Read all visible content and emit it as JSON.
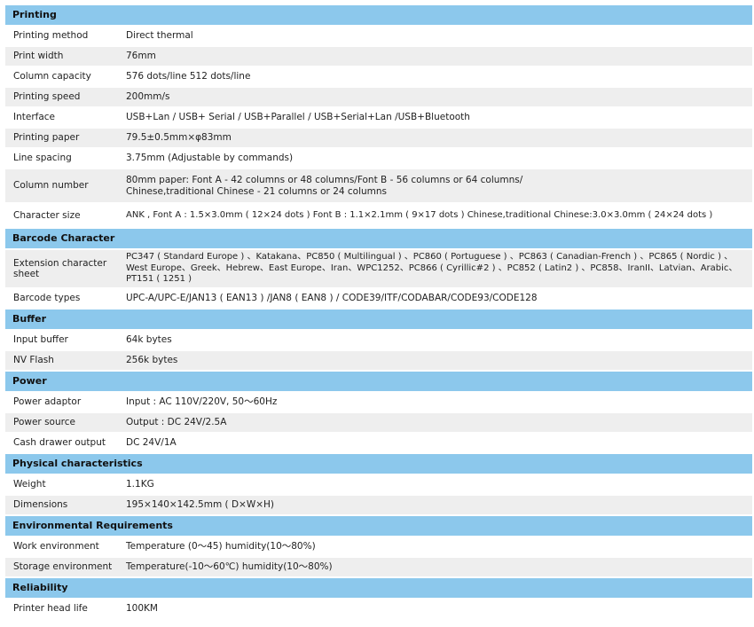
{
  "sections": [
    {
      "title": "Printing",
      "rows": [
        {
          "label": "Printing method",
          "value": "Direct thermal"
        },
        {
          "label": "Print width",
          "value": "76mm"
        },
        {
          "label": "Column capacity",
          "value": "576 dots/line 512 dots/line"
        },
        {
          "label": "Printing speed",
          "value": "200mm/s"
        },
        {
          "label": "Interface",
          "value": "USB+Lan / USB+ Serial / USB+Parallel / USB+Serial+Lan /USB+Bluetooth"
        },
        {
          "label": "Printing paper",
          "value": "79.5±0.5mm×φ83mm"
        },
        {
          "label": "Line spacing",
          "value": "3.75mm (Adjustable by commands)"
        },
        {
          "label": "Column number",
          "value": "80mm paper: Font A - 42 columns or 48 columns/Font B - 56 columns or 64 columns/ Chinese,traditional Chinese - 21 columns or 24 columns"
        },
        {
          "label": "Character size",
          "value": "ANK , Font A : 1.5×3.0mm ( 12×24 dots ) Font B : 1.1×2.1mm ( 9×17 dots ) Chinese,traditional Chinese:3.0×3.0mm ( 24×24 dots )"
        }
      ]
    },
    {
      "title": "Barcode Character",
      "rows": [
        {
          "label": "Extension character sheet",
          "value": "PC347 ( Standard Europe ) 、Katakana、PC850 ( Multilingual ) 、PC860 ( Portuguese ) 、PC863 ( Canadian-French ) 、PC865 ( Nordic ) 、West Europe、Greek、Hebrew、East Europe、Iran、WPC1252、PC866 ( Cyrillic#2 ) 、PC852 ( Latin2 ) 、PC858、IranII、Latvian、Arabic、PT151 ( 1251 )"
        },
        {
          "label": "Barcode types",
          "value": "UPC-A/UPC-E/JAN13 ( EAN13 ) /JAN8 ( EAN8 ) / CODE39/ITF/CODABAR/CODE93/CODE128"
        }
      ]
    },
    {
      "title": "Buffer",
      "rows": [
        {
          "label": "Input buffer",
          "value": "64k bytes"
        },
        {
          "label": "NV Flash",
          "value": "256k bytes"
        }
      ]
    },
    {
      "title": "Power",
      "rows": [
        {
          "label": "Power adaptor",
          "value": "Input : AC 110V/220V, 50～60Hz"
        },
        {
          "label": "Power source",
          "value": "Output : DC 24V/2.5A"
        },
        {
          "label": "Cash drawer output",
          "value": "DC 24V/1A"
        }
      ]
    },
    {
      "title": "Physical characteristics",
      "rows": [
        {
          "label": "Weight",
          "value": "1.1KG"
        },
        {
          "label": "Dimensions",
          "value": "195×140×142.5mm ( D×W×H)"
        }
      ]
    },
    {
      "title": "Environmental Requirements",
      "rows": [
        {
          "label": "Work environment",
          "value": "Temperature (0～45) humidity(10～80%)"
        },
        {
          "label": "Storage environment",
          "value": "Temperature(-10～60℃) humidity(10～80%)"
        }
      ]
    },
    {
      "title": "Reliability",
      "rows": [
        {
          "label": "Printer head life",
          "value": "100KM"
        }
      ]
    }
  ]
}
